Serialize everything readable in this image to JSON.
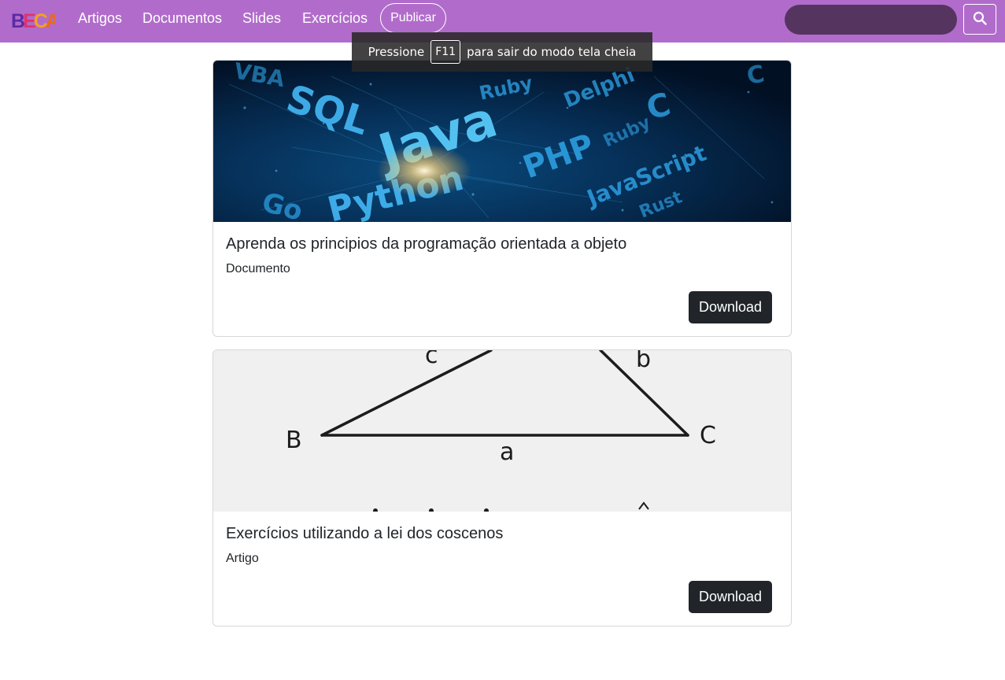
{
  "navbar": {
    "logo_text": "BECA",
    "links": [
      {
        "label": "Artigos"
      },
      {
        "label": "Documentos"
      },
      {
        "label": "Slides"
      },
      {
        "label": "Exercícios"
      }
    ],
    "publish_label": "Publicar",
    "search_placeholder": "",
    "colors": {
      "background": "#b16ccb",
      "search_bg": "#553560"
    }
  },
  "fullscreen_notice": {
    "prefix": "Pressione",
    "key": "F11",
    "suffix": "para sair do modo tela cheia"
  },
  "cards": [
    {
      "title": "Aprenda os principios da programação orientada a objeto",
      "type": "Documento",
      "button": "Download",
      "image": {
        "kind": "programming-languages",
        "words": [
          "VBA",
          "SQL",
          "Ruby",
          "Java",
          "Delphi",
          "C",
          "Go",
          "Python",
          "PHP",
          "Ruby",
          "JavaScript",
          "Rust",
          "C"
        ]
      }
    },
    {
      "title": "Exercícios utilizando a lei dos coscenos",
      "type": "Artigo",
      "button": "Download",
      "image": {
        "kind": "triangle",
        "labels": [
          "c",
          "b",
          "B",
          "a",
          "C"
        ]
      }
    }
  ]
}
